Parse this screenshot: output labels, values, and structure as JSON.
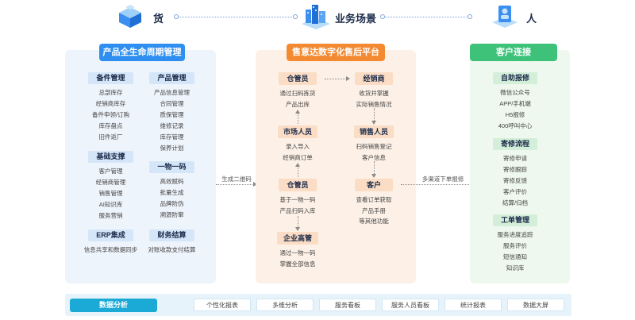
{
  "header": {
    "left_label": "货",
    "center_label": "业务场景",
    "right_label": "人"
  },
  "left_panel": {
    "title": "产品全生命周期管理",
    "sections": [
      {
        "title": "备件管理",
        "items": [
          "总部库存",
          "经销商库存",
          "备件申领/订购",
          "库存盘点",
          "旧件返厂"
        ]
      },
      {
        "title": "产品管理",
        "items": [
          "产品信息管理",
          "合同管理",
          "质保管理",
          "维修记录",
          "库存管理",
          "保养计划"
        ]
      },
      {
        "title": "基础支撑",
        "items": [
          "客户管理",
          "经销商管理",
          "销售管理",
          "AI知识库",
          "服务营销"
        ]
      },
      {
        "title": "一物一码",
        "items": [
          "高效赋码",
          "批量生成",
          "品牌防伪",
          "溯源防窜"
        ]
      },
      {
        "title": "ERP集成",
        "items": [
          "信息共享和数据同步"
        ]
      },
      {
        "title": "财务结算",
        "items": [
          "对账收款支付结算"
        ]
      }
    ]
  },
  "middle_panel": {
    "title": "售意达数字化售后平台",
    "nodes": [
      {
        "title": "仓管员",
        "items": [
          "通过扫码拣货",
          "产品出库"
        ]
      },
      {
        "title": "经销商",
        "items": [
          "收货并掌握",
          "实际销售情况"
        ]
      },
      {
        "title": "市场人员",
        "items": [
          "录入导入",
          "经销商订单"
        ]
      },
      {
        "title": "销售人员",
        "items": [
          "扫码销售登记",
          "客户信息"
        ]
      },
      {
        "title": "仓管员",
        "items": [
          "基于一物一码",
          "产品扫码入库"
        ]
      },
      {
        "title": "客户",
        "items": [
          "查看订单获取",
          "产品手册",
          "等其他功能"
        ]
      },
      {
        "title": "企业高管",
        "items": [
          "通过一物一码",
          "掌握全部信息"
        ]
      }
    ]
  },
  "right_panel": {
    "title": "客户连接",
    "sections": [
      {
        "title": "自助报修",
        "items": [
          "微信公众号",
          "APP/手机端",
          "H5报修",
          "400呼叫中心"
        ]
      },
      {
        "title": "寄修流程",
        "items": [
          "寄修申请",
          "寄修跟踪",
          "寄修反馈",
          "客户评价",
          "结算/归档"
        ]
      },
      {
        "title": "工单管理",
        "items": [
          "服务进度追踪",
          "服务评价",
          "短信通知",
          "知识库"
        ]
      }
    ]
  },
  "connectors": {
    "left_to_mid": "生成二维码",
    "mid_to_right": "多渠道下单报修"
  },
  "bottom": {
    "title": "数据分析",
    "items": [
      "个性化报表",
      "多维分析",
      "服务看板",
      "服务人员看板",
      "统计报表",
      "数据大屏"
    ]
  },
  "colors": {
    "blue": "#2f8ff0",
    "orange": "#f38a32",
    "green": "#3ec27a",
    "cyan": "#1ba9d6"
  },
  "icons": [
    "box-cube-icon",
    "city-buildings-icon",
    "person-card-icon"
  ]
}
